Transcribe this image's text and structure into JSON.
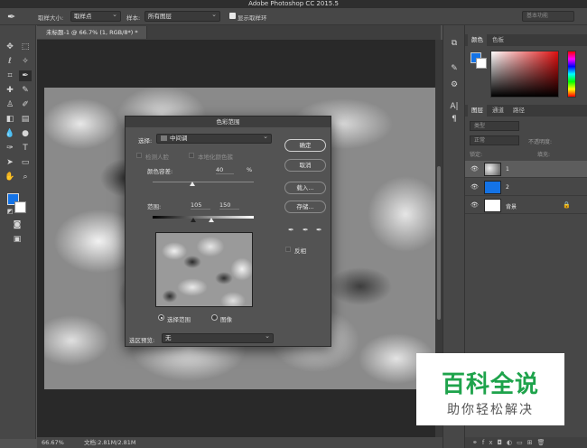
{
  "app": {
    "title": "Adobe Photoshop CC 2015.5"
  },
  "options_bar": {
    "sample_size_label": "取样大小:",
    "sample_size_value": "取样点",
    "sample_label": "样本:",
    "sample_value": "所有图层",
    "show_ring_label": "显示取样环",
    "workspace": "基本功能"
  },
  "document": {
    "tab_title": "未标题-1 @ 66.7% (1, RGB/8*) *",
    "zoom": "66.67%",
    "doc_size": "文档:2.81M/2.81M"
  },
  "dialog": {
    "title": "色彩范围",
    "select_label": "选择:",
    "select_value": "中间调",
    "detect_faces": "检测人脸",
    "localized_clusters": "本地化颜色簇",
    "fuzziness_label": "颜色容差:",
    "fuzziness_value": "40",
    "fuzziness_unit": "%",
    "range_label": "范围:",
    "range_low": "105",
    "range_high": "150",
    "radio_selection": "选择范围",
    "radio_image": "图像",
    "selection_preview_label": "选区预览:",
    "selection_preview_value": "无",
    "buttons": {
      "ok": "确定",
      "cancel": "取消",
      "load": "载入...",
      "save": "存储..."
    },
    "invert_label": "反相"
  },
  "panels": {
    "color_tabs": [
      "颜色",
      "色板"
    ],
    "layer_tabs": [
      "图层",
      "通道",
      "路径"
    ],
    "search_placeholder": "类型",
    "blend_mode": "正常",
    "opacity_label": "不透明度:",
    "lock_label": "锁定:",
    "fill_label": "填充:",
    "layers": [
      {
        "name": "1"
      },
      {
        "name": "2"
      },
      {
        "name": "背景"
      }
    ],
    "colors": {
      "foreground": "#1473e6",
      "background": "#ffffff"
    }
  },
  "watermark": {
    "main": "百科全说",
    "sub": "助你轻松解决"
  }
}
